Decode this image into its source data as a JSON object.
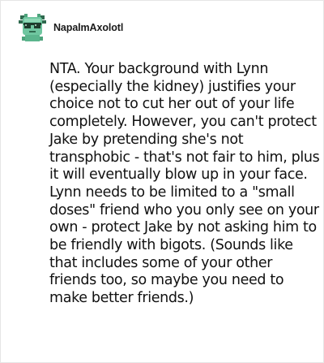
{
  "post": {
    "username": "NapalmAxolotl",
    "avatar_icon": "axolotl-sunglasses-avatar-icon",
    "body": "NTA. Your background with Lynn (especially the kidney) justifies your choice not to cut her out of your life completely. However, you can't protect Jake by pretending she's not transphobic - that's not fair to him, plus it will eventually blow up in your face. Lynn needs to be limited to a \"small doses\" friend who you only see on your own - protect Jake by not asking him to be friendly with bigots. (Sounds like that includes some of your other friends too, so maybe you need to make better friends.)"
  },
  "colors": {
    "avatar_bg": "#6fc6a0",
    "avatar_dark": "#1e3b2c",
    "text": "#111111"
  }
}
